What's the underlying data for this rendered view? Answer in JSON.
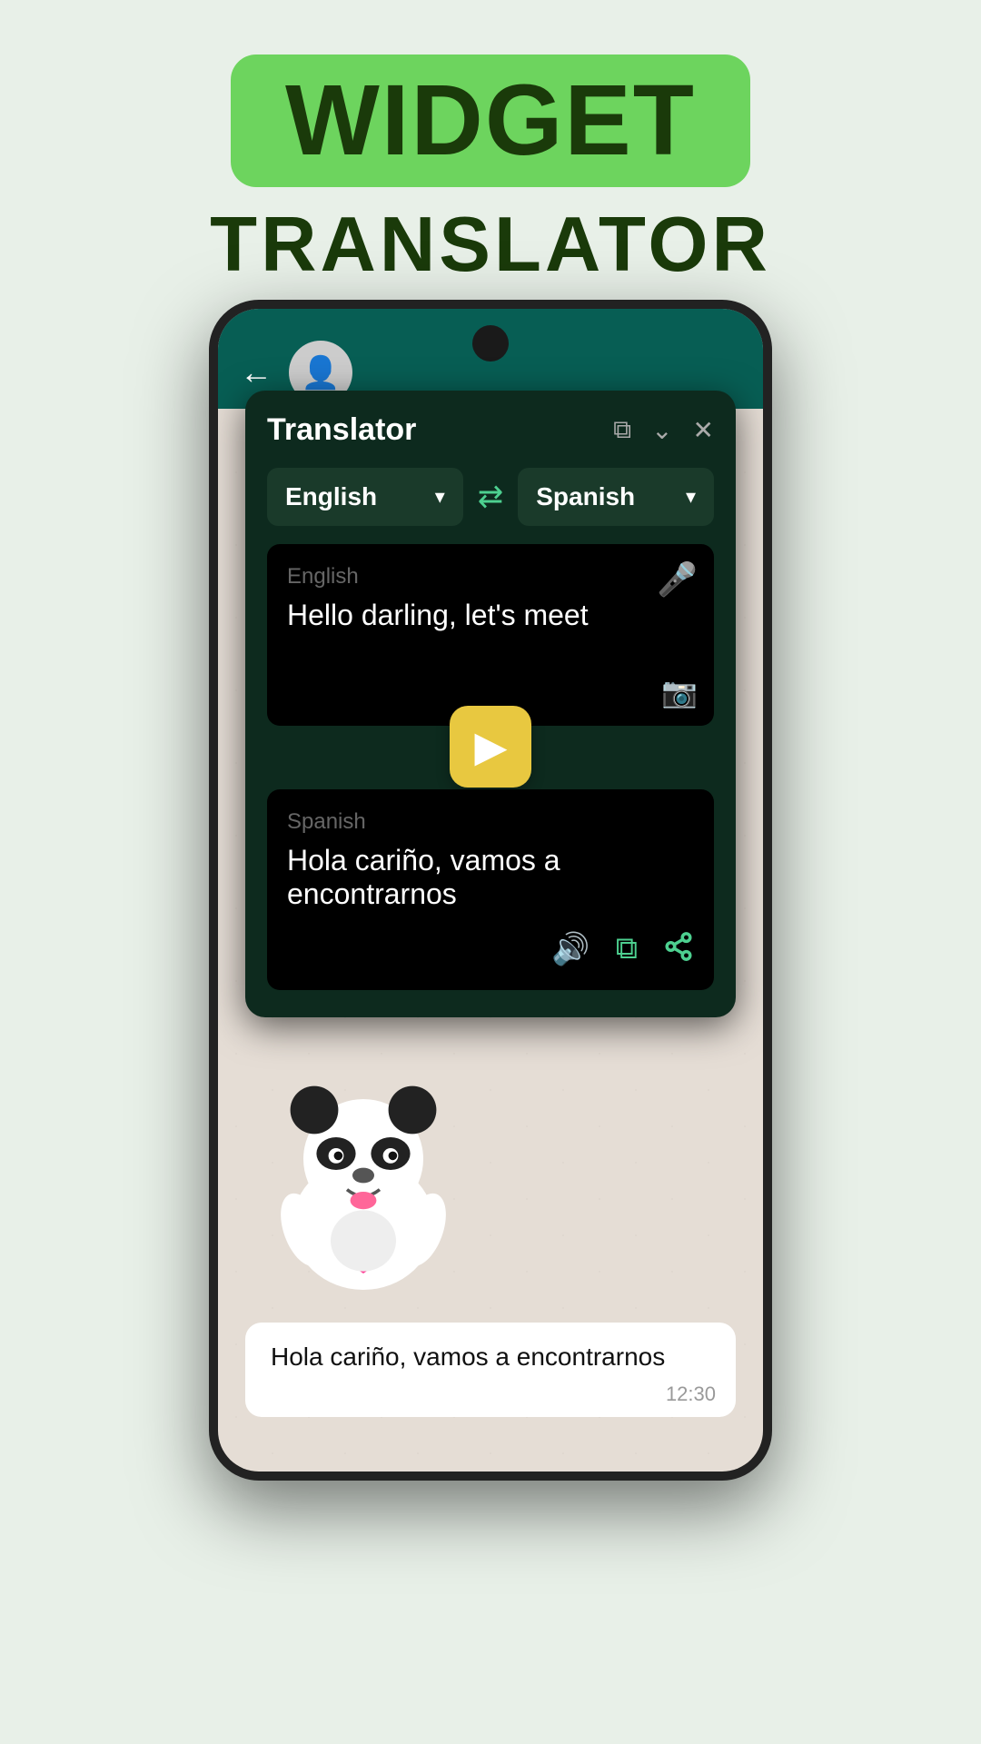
{
  "app": {
    "title_badge": "WIDGET",
    "title_sub": "TRANSLATOR"
  },
  "header": {
    "back_icon": "←",
    "avatar_emoji": "👤"
  },
  "widget": {
    "title": "Translator",
    "copy_icon": "⧉",
    "minimize_icon": "⌄",
    "close_icon": "✕",
    "source_lang": "English",
    "target_lang": "Spanish",
    "swap_icon": "⇄",
    "input_label": "English",
    "input_text": "Hello darling, let's meet",
    "mic_icon": "🎤",
    "camera_icon": "📷",
    "translate_button": "▶",
    "output_label": "Spanish",
    "output_text": "Hola cariño, vamos a encontrarnos",
    "speaker_icon": "🔊",
    "copy2_icon": "⧉",
    "share_icon": "↗"
  },
  "chat": {
    "message": "Hola cariño, vamos a encontrarnos",
    "time": "12:30"
  }
}
